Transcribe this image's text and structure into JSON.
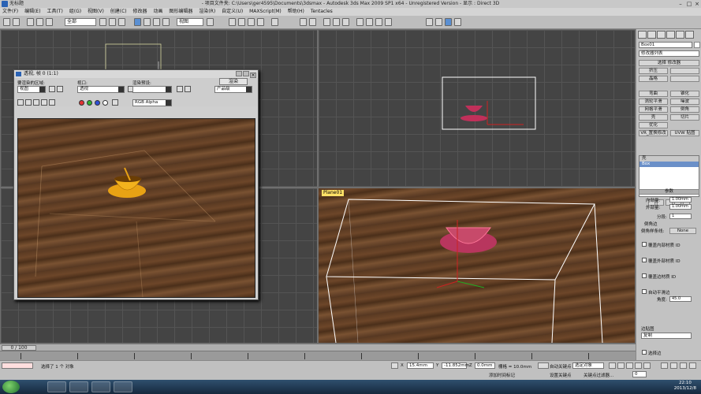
{
  "window": {
    "left_title": "无标题",
    "main_title": "- 项目文件夹: C:\\Users\\ger4595\\Documents\\3dsmax    - Autodesk 3ds Max  2009 SP1  x64    - Unregistered Version    - 显示 : Direct 3D"
  },
  "menu": [
    "文件(F)",
    "编辑(E)",
    "工具(T)",
    "组(G)",
    "视图(V)",
    "创建(C)",
    "修改器",
    "动画",
    "图形编辑器",
    "渲染(R)",
    "自定义(U)",
    "MAXScript(M)",
    "帮助(H)",
    "Tentacles"
  ],
  "toolbar": {
    "selection_filter": "全部",
    "ref_coord": "视图"
  },
  "render_window": {
    "title": "透视, 帧 0 (1:1)",
    "area_label": "要渲染的区域:",
    "area_value": "视图",
    "viewport_label": "视口:",
    "viewport_value": "透视",
    "preset_label": "渲染预设:",
    "render_button": "渲染",
    "product_value": "产品级",
    "channel_value": "RGB Alpha"
  },
  "viewports": {
    "perspective_label": "Plane01"
  },
  "command_panel": {
    "object_name": "Box01",
    "modifier_list": "修改器列表",
    "buttons": [
      "选择 修改器",
      "挤压",
      "晶格",
      "弯曲",
      "锥化",
      "涡轮平滑",
      "噪波",
      "网格平滑",
      "倒角",
      "壳",
      "切片",
      "优化",
      "VR_置换修改",
      "UVW 贴图"
    ],
    "stack_selected": "Box",
    "stack_item": "壳",
    "params_title": "参数",
    "inner_label": "内部量:",
    "inner_value": "1.00mm",
    "outer_label": "外部量:",
    "outer_value": "1.00mm",
    "segments_label": "分段:",
    "segments_value": "1",
    "bevel_edge_label": "倒角边",
    "bevel_spline_label": "倒角样条线:",
    "bevel_spline_value": "None",
    "override_inner_label": "覆盖内部材质 ID",
    "override_outer_label": "覆盖外部材质 ID",
    "override_edge_label": "覆盖边材质 ID",
    "auto_smooth_label": "自动平滑边",
    "angle_label": "角度:",
    "angle_value": "45.0",
    "edge_mapping_label": "边贴图",
    "edge_mapping_value": "复制",
    "select_edges_label": "选择边"
  },
  "timeline": {
    "slider_label": "0 / 100"
  },
  "status": {
    "selection_text": "选择了 1 个 对象",
    "x_value": "15.4mm",
    "y_value": "-11.852mm",
    "z_value": "0.0mm",
    "grid_text": "栅格 = 10.0mm",
    "auto_key_label": "自动关键点",
    "auto_key_value": "选定对象",
    "set_key_label": "设置关键点",
    "key_filter": "关键点过滤器...",
    "add_time_tag": "添加时间标记",
    "frame_value": "0"
  },
  "taskbar": {
    "time": "22:10",
    "date": "2013/12/8"
  }
}
